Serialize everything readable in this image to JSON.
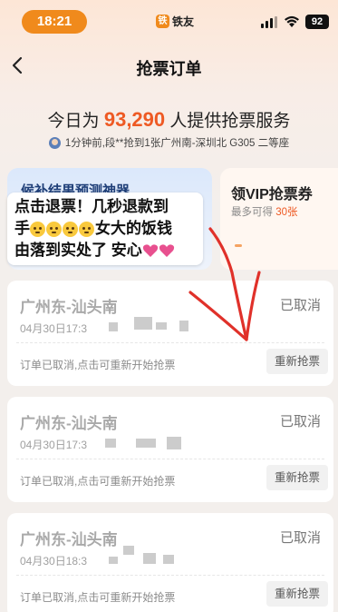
{
  "status_bar": {
    "time": "18:21",
    "app_logo": "铁",
    "app_name": "铁友",
    "battery": "92"
  },
  "nav": {
    "title": "抢票订单"
  },
  "stats": {
    "prefix": "今日为",
    "count": "93,290",
    "suffix": "人提供抢票服务"
  },
  "ticker": {
    "text": "1分钟前,段**抢到1张广州南-深圳北 G305 二等座"
  },
  "promo": {
    "left_title": "候补结果预测神器",
    "right_title": "领VIP抢票券",
    "right_sub_prefix": "最多可得",
    "right_sub_highlight": "30张"
  },
  "caption": {
    "line1": "点击退票！几秒退款到",
    "line2_start": "手",
    "line2_end": "女大的饭钱",
    "line3": "由落到实处了 安心"
  },
  "orders": [
    {
      "route": "广州东-汕头南",
      "status": "已取消",
      "date": "04月30日17:3",
      "note": "订单已取消,点击可重新开始抢票",
      "button": "重新抢票"
    },
    {
      "route": "广州东-汕头南",
      "status": "已取消",
      "date": "04月30日17:3",
      "note": "订单已取消,点击可重新开始抢票",
      "button": "重新抢票"
    },
    {
      "route": "广州东-汕头南",
      "status": "已取消",
      "date": "04月30日18:3",
      "note": "订单已取消,点击可重新开始抢票",
      "button": "重新抢票"
    }
  ],
  "colors": {
    "accent": "#ee5a24",
    "brand": "#f08a1c",
    "arrow": "#e0312a"
  },
  "icons": [
    "back-arrow-icon",
    "signal-icon",
    "wifi-icon",
    "crying-face-icon",
    "heart-icon",
    "drawn-arrow-icon"
  ]
}
